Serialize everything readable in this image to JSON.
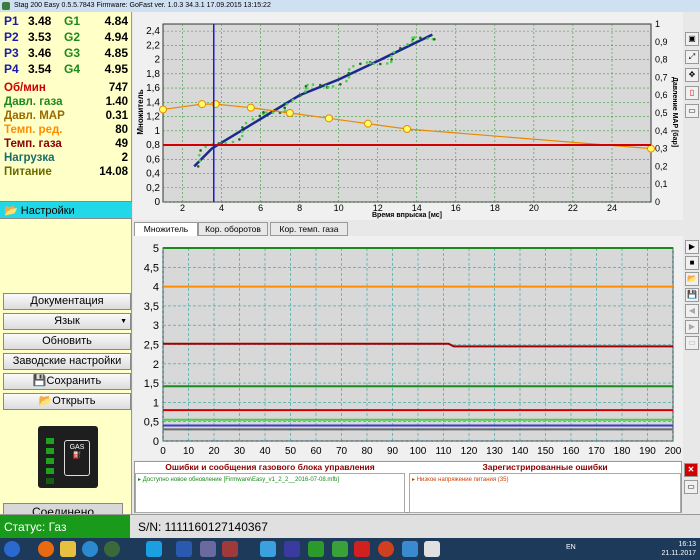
{
  "window": {
    "title": "Stag 200 Easy 0.5.5.7843 Firmware: GoFast  ver. 1.0.3  34.3.1  17.09.2015 13:15:22"
  },
  "injectors": [
    {
      "p": "P1",
      "pv": "3.48",
      "g": "G1",
      "gv": "4.84"
    },
    {
      "p": "P2",
      "pv": "3.53",
      "g": "G2",
      "gv": "4.94"
    },
    {
      "p": "P3",
      "pv": "3.46",
      "g": "G3",
      "gv": "4.85"
    },
    {
      "p": "P4",
      "pv": "3.54",
      "g": "G4",
      "gv": "4.95"
    }
  ],
  "sensors": [
    {
      "label": "Об/мин",
      "value": "747",
      "color": "#d00000"
    },
    {
      "label": "Давл. газа",
      "value": "1.40",
      "color": "#1a8a1a"
    },
    {
      "label": "Давл. MAP",
      "value": "0.31",
      "color": "#9a6a00"
    },
    {
      "label": "Темп. ред.",
      "value": "80",
      "color": "#ff8c00"
    },
    {
      "label": "Темп. газа",
      "value": "49",
      "color": "#8a0000"
    },
    {
      "label": "Нагрузка",
      "value": "2",
      "color": "#1a6a6a"
    },
    {
      "label": "Питание",
      "value": "14.08",
      "color": "#6a6a00"
    }
  ],
  "sidebar": {
    "settings": "Настройки",
    "documentation": "Документация",
    "language": "Язык",
    "update": "Обновить",
    "factory": "Заводские настройки",
    "save": "Сохранить",
    "open": "Открыть",
    "connected": "Соединено",
    "gas_label": "GAS"
  },
  "tabs": [
    {
      "label": "Множитель"
    },
    {
      "label": "Кор. оборотов"
    },
    {
      "label": "Кор. темп. газа"
    }
  ],
  "top_chart": {
    "y_ticks": [
      "0",
      "0,2",
      "0,4",
      "0,6",
      "0,8",
      "1",
      "1,2",
      "1,4",
      "1,6",
      "1,8",
      "2",
      "2,2",
      "2,4"
    ],
    "y2_ticks": [
      "0",
      "0,1",
      "0,2",
      "0,3",
      "0,4",
      "0,5",
      "0,6",
      "0,7",
      "0,8",
      "0,9",
      "1"
    ],
    "x_ticks": [
      "2",
      "4",
      "6",
      "8",
      "10",
      "12",
      "14",
      "16",
      "18",
      "20",
      "22",
      "24"
    ],
    "ylabel": "Множитель",
    "y2label": "Давление MAP [бар]",
    "xlabel": "Время впрыска [мс]"
  },
  "bottom_chart": {
    "y_ticks": [
      "0",
      "0,5",
      "1",
      "1,5",
      "2",
      "2,5",
      "3",
      "3,5",
      "4",
      "4,5",
      "5"
    ],
    "x_ticks": [
      "0",
      "10",
      "20",
      "30",
      "40",
      "50",
      "60",
      "70",
      "80",
      "90",
      "100",
      "110",
      "120",
      "130",
      "140",
      "150",
      "160",
      "170",
      "180",
      "190",
      "200"
    ]
  },
  "chart_data": [
    {
      "type": "scatter",
      "xlabel": "Время впрыска [мс]",
      "ylabel": "Множитель",
      "y2label": "Давление MAP [бар]",
      "xlim": [
        1,
        26
      ],
      "ylim": [
        0,
        2.5
      ],
      "y2lim": [
        0,
        1
      ],
      "series": [
        {
          "color": "#1a2a8a",
          "kind": "line",
          "x": [
            2.6,
            3.5,
            5,
            6.5,
            8,
            10,
            12,
            14.8
          ],
          "y": [
            0.5,
            0.75,
            1.0,
            1.25,
            1.5,
            1.72,
            1.98,
            2.35
          ]
        },
        {
          "color": "#e88a00",
          "kind": "line-markers",
          "x": [
            1,
            3,
            3.7,
            5.5,
            7.5,
            9.5,
            11.5,
            13.5,
            26
          ],
          "y": [
            0.52,
            0.55,
            0.55,
            0.53,
            0.5,
            0.47,
            0.44,
            0.41,
            0.3
          ],
          "axis": "y2"
        },
        {
          "color": "#d00000",
          "kind": "hline",
          "y": 0.8
        },
        {
          "color": "#1a1ad0",
          "kind": "vline",
          "x": 3.6
        }
      ]
    },
    {
      "type": "line",
      "xlim": [
        0,
        200
      ],
      "ylim": [
        0,
        5
      ],
      "series": [
        {
          "color": "#1a8a1a",
          "x": [
            0,
            200
          ],
          "y": [
            5.0,
            5.0
          ]
        },
        {
          "color": "#ff8c00",
          "x": [
            0,
            200
          ],
          "y": [
            4.0,
            4.0
          ]
        },
        {
          "color": "#a00000",
          "x": [
            0,
            112,
            114,
            200
          ],
          "y": [
            2.52,
            2.52,
            2.45,
            2.45
          ]
        },
        {
          "color": "#1a8a1a",
          "x": [
            0,
            200
          ],
          "y": [
            1.42,
            1.42
          ]
        },
        {
          "color": "#d00000",
          "x": [
            0,
            200
          ],
          "y": [
            0.8,
            0.8
          ]
        },
        {
          "color": "#4ad04a",
          "x": [
            0,
            200
          ],
          "y": [
            0.55,
            0.55
          ]
        },
        {
          "color": "#3a3ad0",
          "x": [
            0,
            200
          ],
          "y": [
            0.4,
            0.4
          ]
        },
        {
          "color": "#6a6a6a",
          "x": [
            0,
            200
          ],
          "y": [
            0.3,
            0.3
          ]
        }
      ]
    }
  ],
  "errors": {
    "left_header": "Ошибки и сообщения газового блока управления",
    "left_msg": "Доступно новое обновление [Firmware\\Easy_v1_2_2__2016-07-08.mfb]",
    "right_header": "Зарегистрированные ошибки",
    "right_msg": "Низкое напряжение питания (35)"
  },
  "status": {
    "state": "Статус: Газ",
    "serial": "S/N: 1111160127140367"
  },
  "tray": {
    "lang": "EN",
    "time": "16:13",
    "date": "21.11.2017"
  }
}
